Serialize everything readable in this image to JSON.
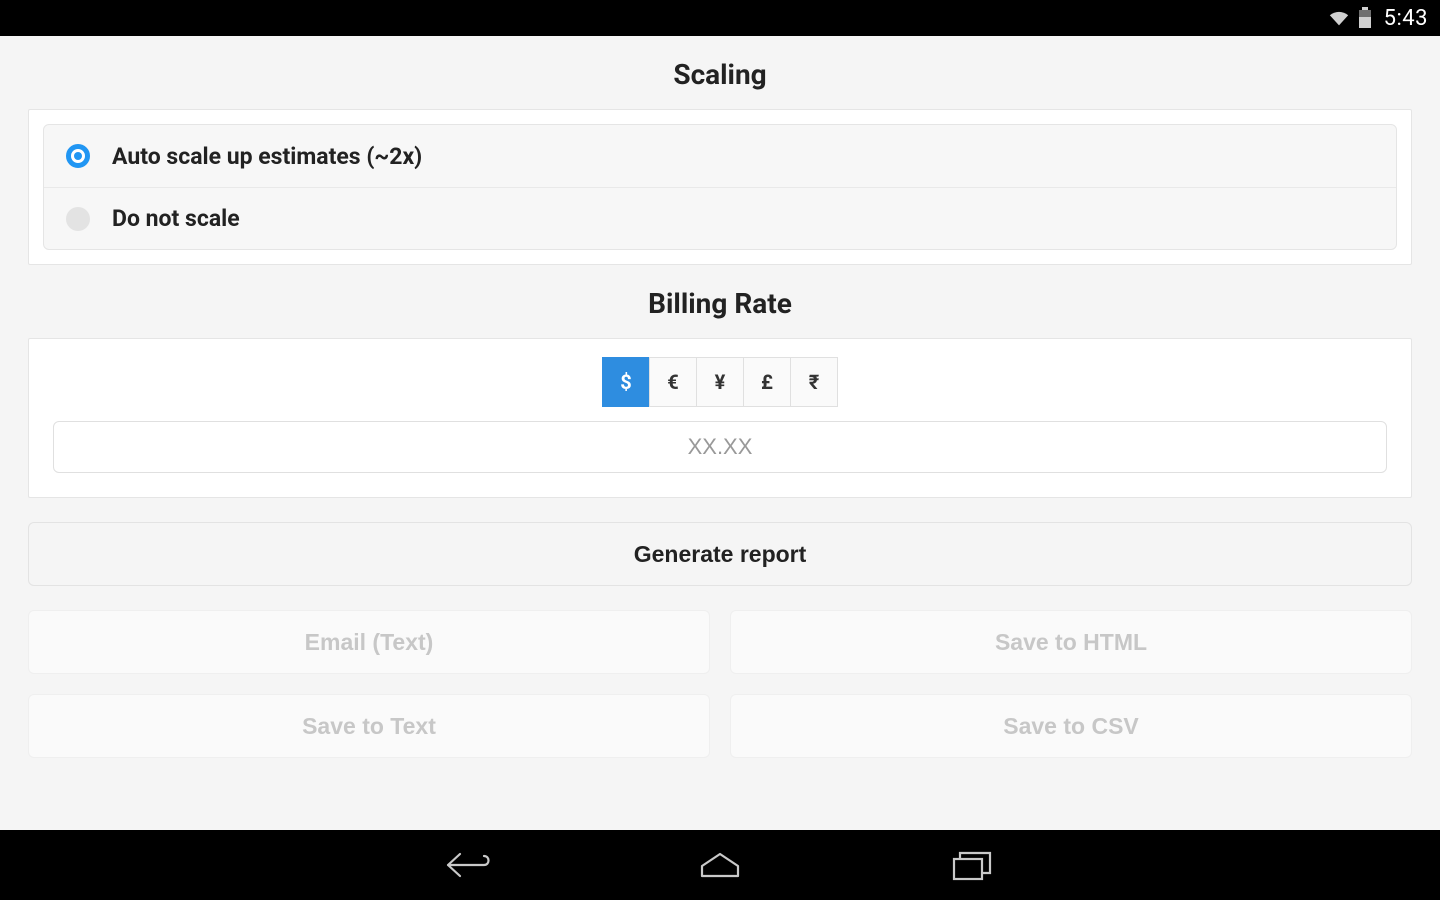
{
  "status_bar": {
    "time": "5:43"
  },
  "sections": {
    "scaling": {
      "title": "Scaling",
      "options": [
        {
          "label": "Auto scale up estimates (~2x)",
          "selected": true
        },
        {
          "label": "Do not scale",
          "selected": false
        }
      ]
    },
    "billing": {
      "title": "Billing Rate",
      "currencies": [
        {
          "symbol": "$",
          "active": true
        },
        {
          "symbol": "€",
          "active": false
        },
        {
          "symbol": "¥",
          "active": false
        },
        {
          "symbol": "£",
          "active": false
        },
        {
          "symbol": "₹",
          "active": false
        }
      ],
      "rate_placeholder": "XX.XX",
      "rate_value": ""
    }
  },
  "actions": {
    "generate_label": "Generate report",
    "exports": [
      "Email (Text)",
      "Save to HTML",
      "Save to Text",
      "Save to CSV"
    ]
  },
  "colors": {
    "accent": "#2196f3",
    "seg_active": "#2e8de0"
  }
}
